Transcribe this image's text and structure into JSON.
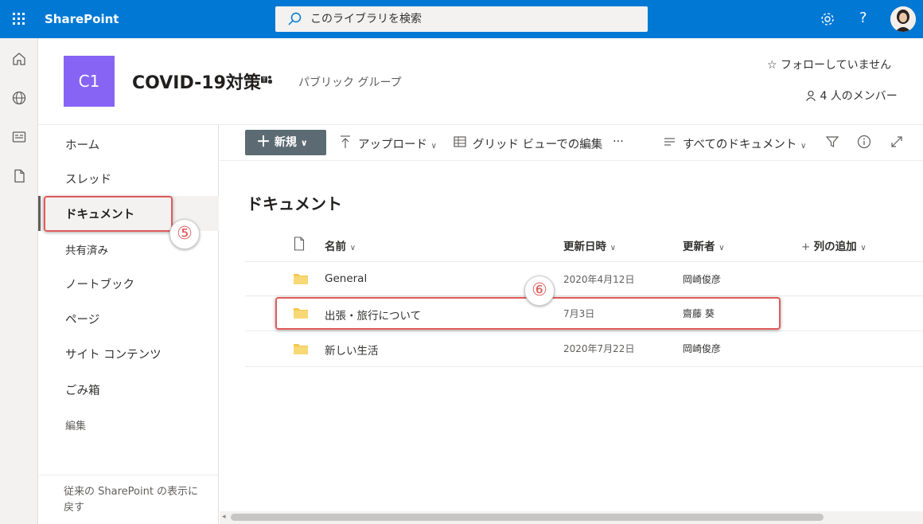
{
  "header": {
    "app_name": "SharePoint",
    "search_placeholder": "このライブラリを検索",
    "help_label": "?"
  },
  "site": {
    "logo_text": "C1",
    "title": "COVID-19対策",
    "group_type": "パブリック グループ",
    "follow_label": "フォローしていません",
    "members_label": "4 人のメンバー",
    "logo_color": "#8764f4"
  },
  "nav": {
    "items": [
      "ホーム",
      "スレッド",
      "ドキュメント",
      "共有済み",
      "ノートブック",
      "ページ",
      "サイト コンテンツ",
      "ごみ箱"
    ],
    "active_index": 2,
    "edit_label": "編集",
    "classic_label": "従来の SharePoint の表示に戻す"
  },
  "commands": {
    "new_label": "新規",
    "upload_label": "アップロード",
    "grid_edit_label": "グリッド ビューでの編集",
    "more_label": "···",
    "view_label": "すべてのドキュメント"
  },
  "library": {
    "title": "ドキュメント",
    "columns": {
      "name": "名前",
      "modified": "更新日時",
      "modified_by": "更新者",
      "add_column": "列の追加"
    },
    "rows": [
      {
        "name": "General",
        "modified": "2020年4月12日",
        "modified_by": "岡崎俊彦"
      },
      {
        "name": "出張・旅行について",
        "modified": "7月3日",
        "modified_by": "齋藤 葵"
      },
      {
        "name": "新しい生活",
        "modified": "2020年7月22日",
        "modified_by": "岡崎俊彦"
      }
    ]
  },
  "callouts": {
    "five": "⑤",
    "six": "⑥"
  },
  "colors": {
    "brand": "#0078d4",
    "callout": "#e05a5a",
    "new_button": "#5c6b73",
    "folder": "#f2c94c"
  }
}
